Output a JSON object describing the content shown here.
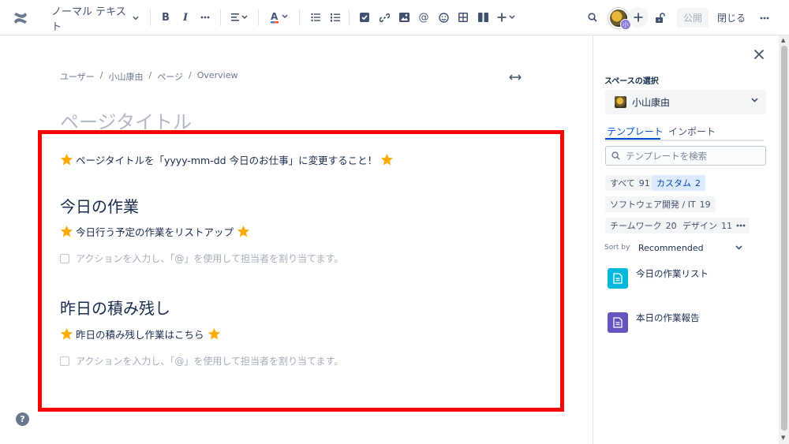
{
  "toolbar": {
    "text_style": "ノーマル テキスト",
    "publish_label": "公開",
    "close_label": "閉じる",
    "avatar_badge": "小"
  },
  "breadcrumb": [
    "ユーザー",
    "小山康由",
    "ページ",
    "Overview"
  ],
  "page_title_placeholder": "ページタイトル",
  "content": {
    "intro": "ページタイトルを「yyyy-mm-dd 今日のお仕事」に変更すること！",
    "section1_heading": "今日の作業",
    "section1_note": "今日行う予定の作業をリストアップ",
    "section1_task_placeholder": "アクションを入力し、「@」を使用して担当者を割り当てます。",
    "section2_heading": "昨日の積み残し",
    "section2_note": "昨日の積み残し作業はこちら",
    "section2_task_placeholder": "アクションを入力し、「@」を使用して担当者を割り当てます。"
  },
  "panel": {
    "space_label": "スペースの選択",
    "space_name": "小山康由",
    "tabs": [
      "テンプレート",
      "インポート"
    ],
    "search_placeholder": "テンプレートを検索",
    "chips": [
      {
        "label": "すべて",
        "count": "91"
      },
      {
        "label": "カスタム",
        "count": "2"
      },
      {
        "label": "ソフトウェア開発 / IT",
        "count": "19"
      },
      {
        "label": "チームワーク",
        "count": "20"
      },
      {
        "label": "デザイン",
        "count": "11"
      }
    ],
    "sort_label": "Sort by",
    "sort_value": "Recommended",
    "templates": [
      {
        "name": "今日の作業リスト",
        "color": "#00B8D9"
      },
      {
        "name": "本日の作業報告",
        "color": "#6554C0"
      }
    ]
  },
  "colors": {
    "highlight": "#FF0000",
    "star": "#FFAB00",
    "link": "#0052CC"
  }
}
